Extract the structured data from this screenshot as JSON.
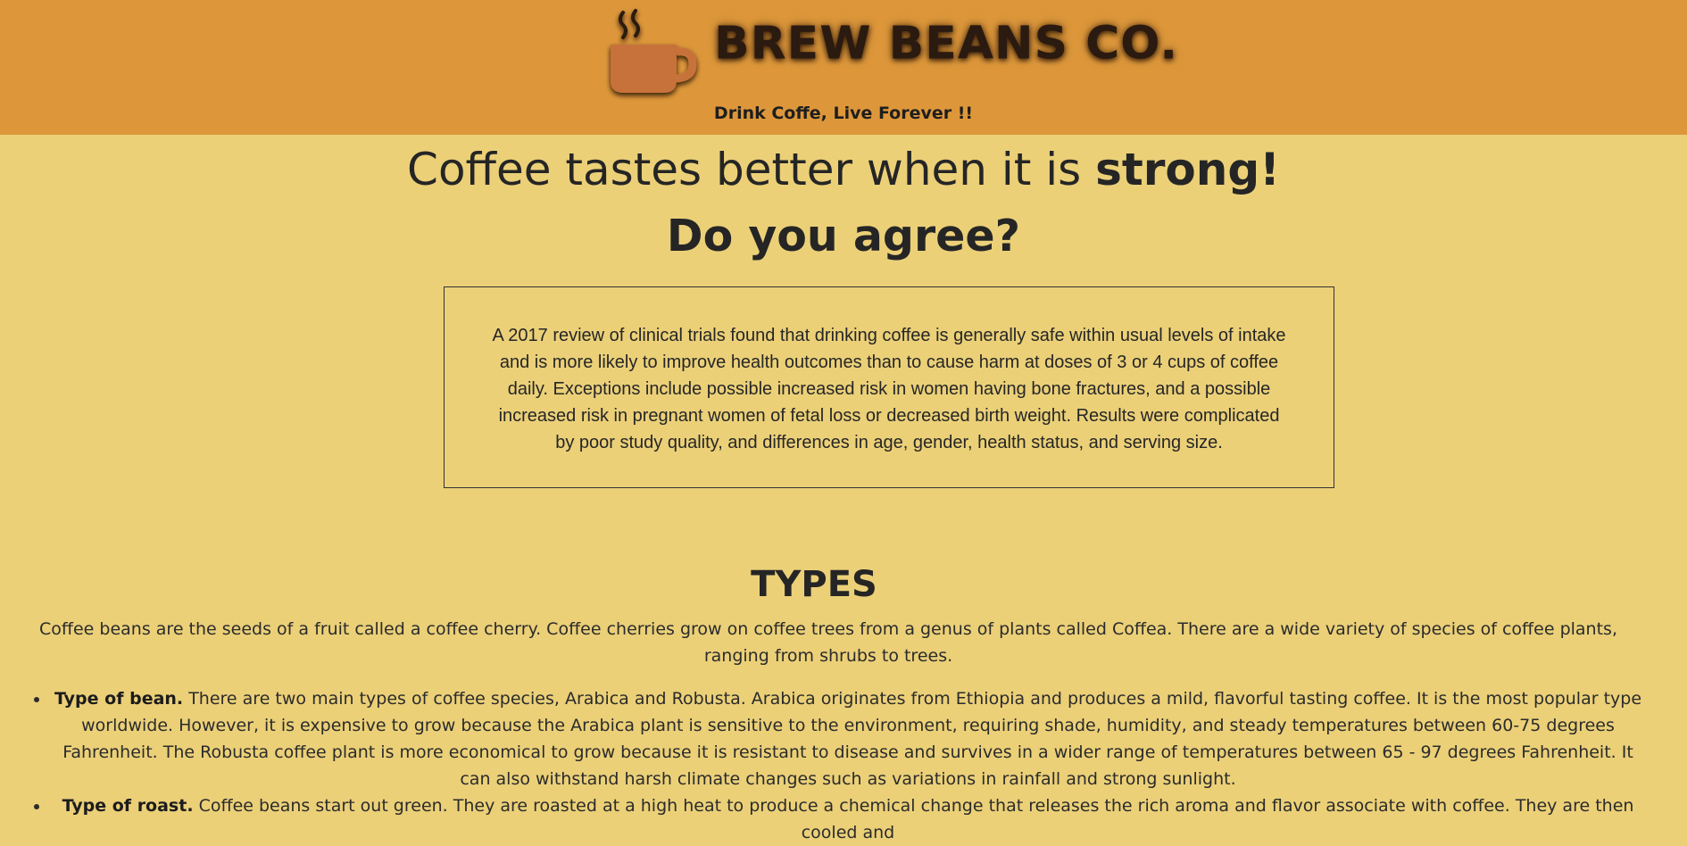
{
  "header": {
    "brand": "BREW BEANS CO.",
    "tagline": "Drink Coffe, Live Forever !!",
    "logo_icon": "coffee-mug-icon",
    "colors": {
      "header_bg": "#dd973a",
      "page_bg": "#ebd078",
      "mug": "#c8723a"
    }
  },
  "hero": {
    "line1_prefix": "Coffee tastes better when it is ",
    "line1_strong": "strong!",
    "line2": "Do you agree?"
  },
  "quote": {
    "text": "A 2017 review of clinical trials found that drinking coffee is generally safe within usual levels of intake and is more likely to improve health outcomes than to cause harm at doses of 3 or 4 cups of coffee daily. Exceptions include possible increased risk in women having bone fractures, and a possible increased risk in pregnant women of fetal loss or decreased birth weight. Results were complicated by poor study quality, and differences in age, gender, health status, and serving size."
  },
  "types": {
    "title": "TYPES",
    "intro": "Coffee beans are the seeds of a fruit called a coffee cherry. Coffee cherries grow on coffee trees from a genus of plants called Coffea. There are a wide variety of species of coffee plants, ranging from shrubs to trees.",
    "items": [
      {
        "heading": "Type of bean.",
        "text": " There are two main types of coffee species, Arabica and Robusta. Arabica originates from Ethiopia and produces a mild, flavorful tasting coffee. It is the most popular type worldwide. However, it is expensive to grow because the Arabica plant is sensitive to the environment, requiring shade, humidity, and steady temperatures between 60-75 degrees Fahrenheit. The Robusta coffee plant is more economical to grow because it is resistant to disease and survives in a wider range of temperatures between 65 - 97 degrees Fahrenheit. It can also withstand harsh climate changes such as variations in rainfall and strong sunlight."
      },
      {
        "heading": "Type of roast.",
        "text": " Coffee beans start out green. They are roasted at a high heat to produce a chemical change that releases the rich aroma and flavor associate with coffee. They are then cooled and"
      }
    ]
  }
}
